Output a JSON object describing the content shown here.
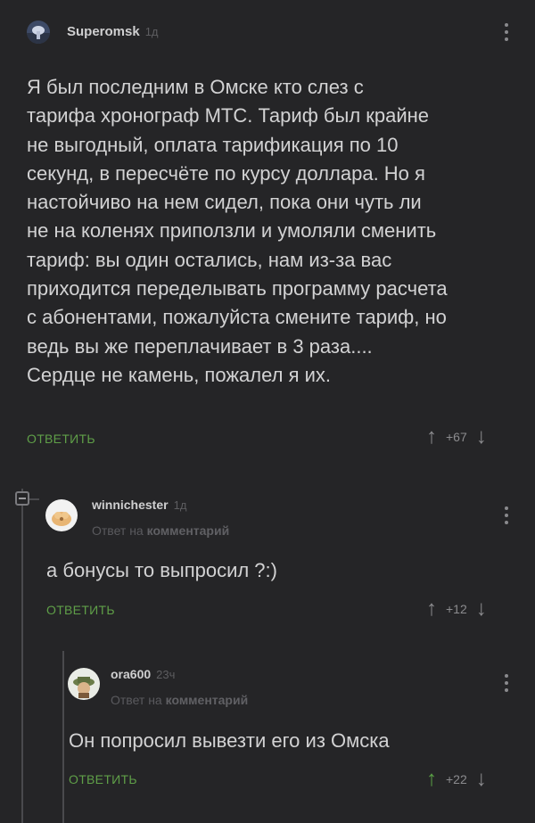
{
  "comments": [
    {
      "user": "Superomsk",
      "time": "1д",
      "lines": [
        "Я был последним в Омске кто слез с",
        "тарифа хронограф МТС. Тариф был крайне",
        "не выгодный, оплата тарификация по 10",
        "секунд, в пересчёте по курсу доллара. Но я",
        "настойчиво на нем сидел, пока они чуть ли",
        "не на коленях приползли и умоляли сменить",
        "тариф: вы один остались, нам из-за вас",
        "приходится переделывать программу расчета",
        "с абонентами, пожалуйста смените тариф, но",
        "ведь вы же переплачивает в 3 раза....",
        "Сердце не камень, пожалел я их."
      ],
      "reply_label": "ОТВЕТИТЬ",
      "rating": "+67"
    },
    {
      "user": "winnichester",
      "time": "1д",
      "reply_to_prefix": "Ответ на",
      "reply_to_link": "комментарий",
      "text": "а бонусы то выпросил ?:)",
      "reply_label": "ОТВЕТИТЬ",
      "rating": "+12"
    },
    {
      "user": "ora600",
      "time": "23ч",
      "reply_to_prefix": "Ответ на",
      "reply_to_link": "комментарий",
      "text": "Он попросил вывезти его из Омска",
      "reply_label": "ОТВЕТИТЬ",
      "rating": "+22"
    }
  ],
  "icons": {
    "upvote": "arrow-up-icon",
    "downvote": "arrow-down-icon",
    "menu": "kebab-menu-icon",
    "collapse": "collapse-thread-icon"
  },
  "colors": {
    "background": "#252527",
    "text": "#d2d2d3",
    "reply_green": "#5f9f48",
    "upvote_active": "#5aa046",
    "muted": "#5a5a5e"
  }
}
